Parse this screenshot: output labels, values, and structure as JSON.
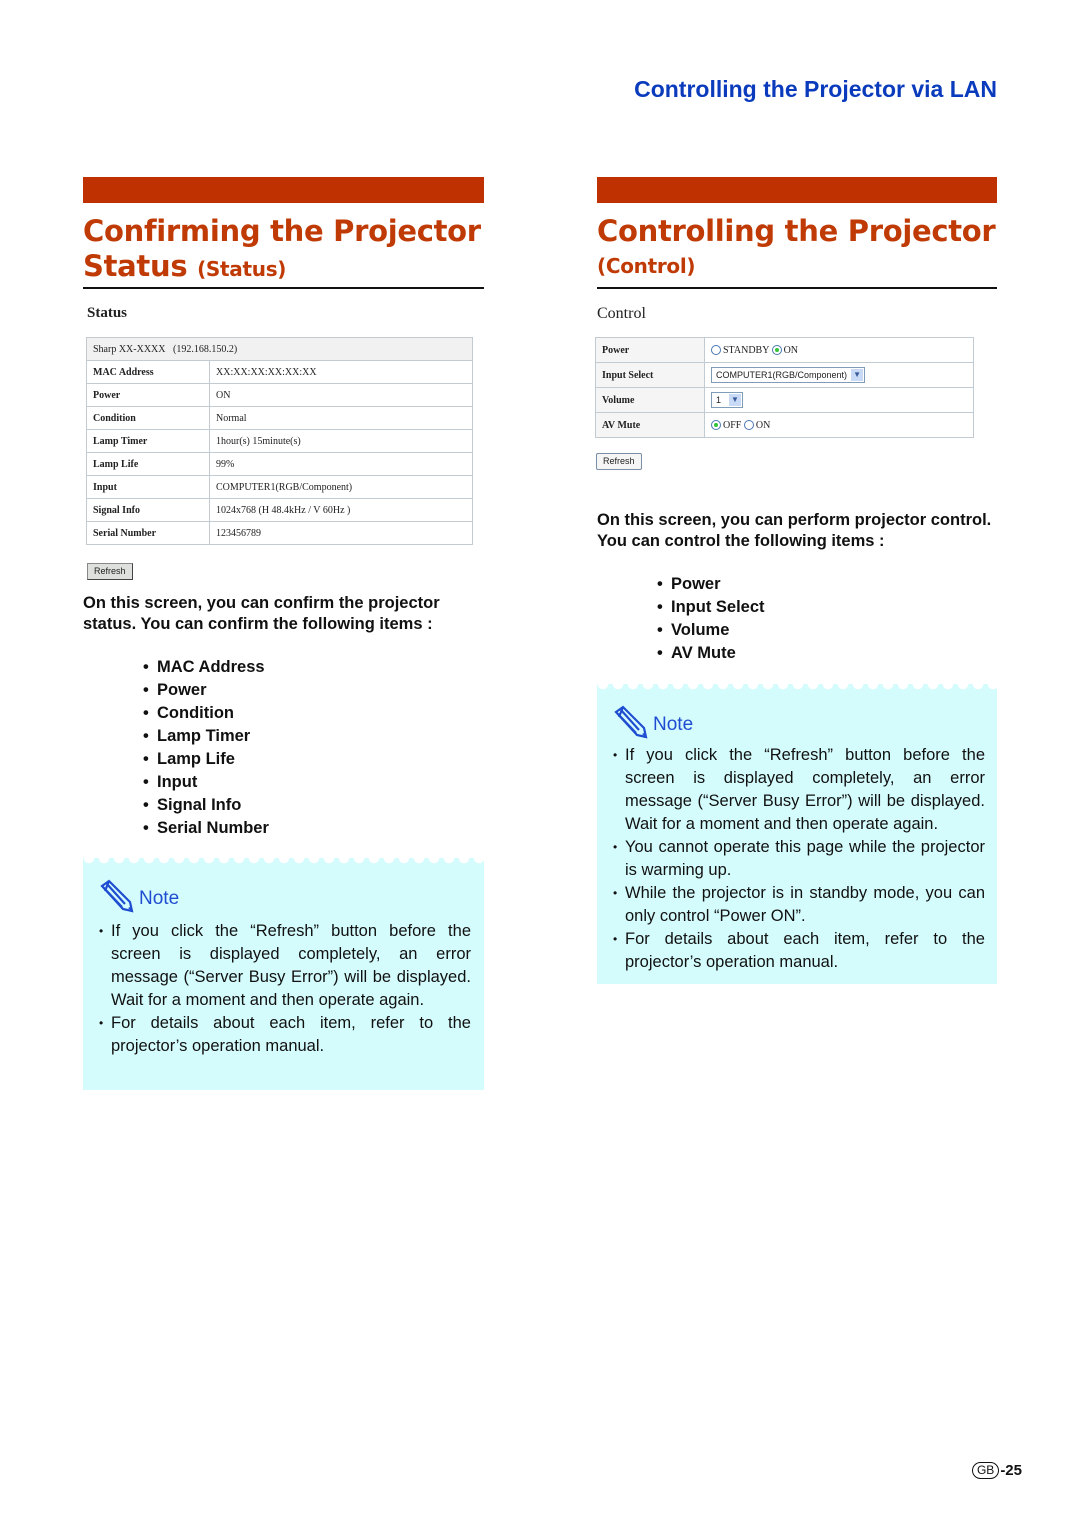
{
  "header": {
    "title": "Controlling the Projector via LAN"
  },
  "left": {
    "section_title_line1": "Confirming the Projector",
    "section_title_line2": "Status",
    "section_title_sub": "(Status)",
    "screenshot": {
      "heading": "Status",
      "device_name": "Sharp XX-XXXX",
      "ip": "(192.168.150.2)",
      "rows": [
        {
          "label": "MAC Address",
          "value": "XX:XX:XX:XX:XX:XX"
        },
        {
          "label": "Power",
          "value": "ON"
        },
        {
          "label": "Condition",
          "value": "Normal"
        },
        {
          "label": "Lamp Timer",
          "value": "1hour(s) 15minute(s)"
        },
        {
          "label": "Lamp Life",
          "value": "99%"
        },
        {
          "label": "Input",
          "value": "COMPUTER1(RGB/Component)"
        },
        {
          "label": "Signal Info",
          "value": "1024x768  (H  48.4kHz  / V  60Hz )"
        },
        {
          "label": "Serial Number",
          "value": "123456789"
        }
      ],
      "refresh_label": "Refresh"
    },
    "intro": "On this screen, you can confirm the projector status. You can confirm the following items :",
    "items": [
      "MAC Address",
      "Power",
      "Condition",
      "Lamp Timer",
      "Lamp Life",
      "Input",
      "Signal Info",
      "Serial Number"
    ],
    "note": {
      "title": "Note",
      "bullets": [
        "If you click the “Refresh” button before the screen is displayed completely, an error message (“Server Busy Error”) will be displayed. Wait for a moment and then operate again.",
        "For details about each item, refer to the projector’s operation manual."
      ]
    }
  },
  "right": {
    "section_title_line1": "Controlling the Projector",
    "section_title_sub": "(Control)",
    "screenshot": {
      "heading": "Control",
      "power_label": "Power",
      "power_options": [
        "STANDBY",
        "ON"
      ],
      "power_selected": "ON",
      "input_label": "Input Select",
      "input_value": "COMPUTER1(RGB/Component)",
      "volume_label": "Volume",
      "volume_value": "1",
      "avmute_label": "AV Mute",
      "avmute_options": [
        "OFF",
        "ON"
      ],
      "avmute_selected": "OFF",
      "refresh_label": "Refresh"
    },
    "intro": "On this screen, you can perform projector control. You can control the following items :",
    "items": [
      "Power",
      "Input Select",
      "Volume",
      "AV Mute"
    ],
    "note": {
      "title": "Note",
      "bullets": [
        "If you click the “Refresh” button before the screen is displayed completely, an error message (“Server Busy Error”) will be displayed. Wait for a moment and then operate again.",
        "You cannot operate this page while the projector is warming up.",
        "While the projector is in standby mode, you can only control “Power ON”.",
        "For details about each item, refer to the projector’s operation manual."
      ]
    }
  },
  "footer": {
    "region": "GB",
    "page": "-25"
  }
}
